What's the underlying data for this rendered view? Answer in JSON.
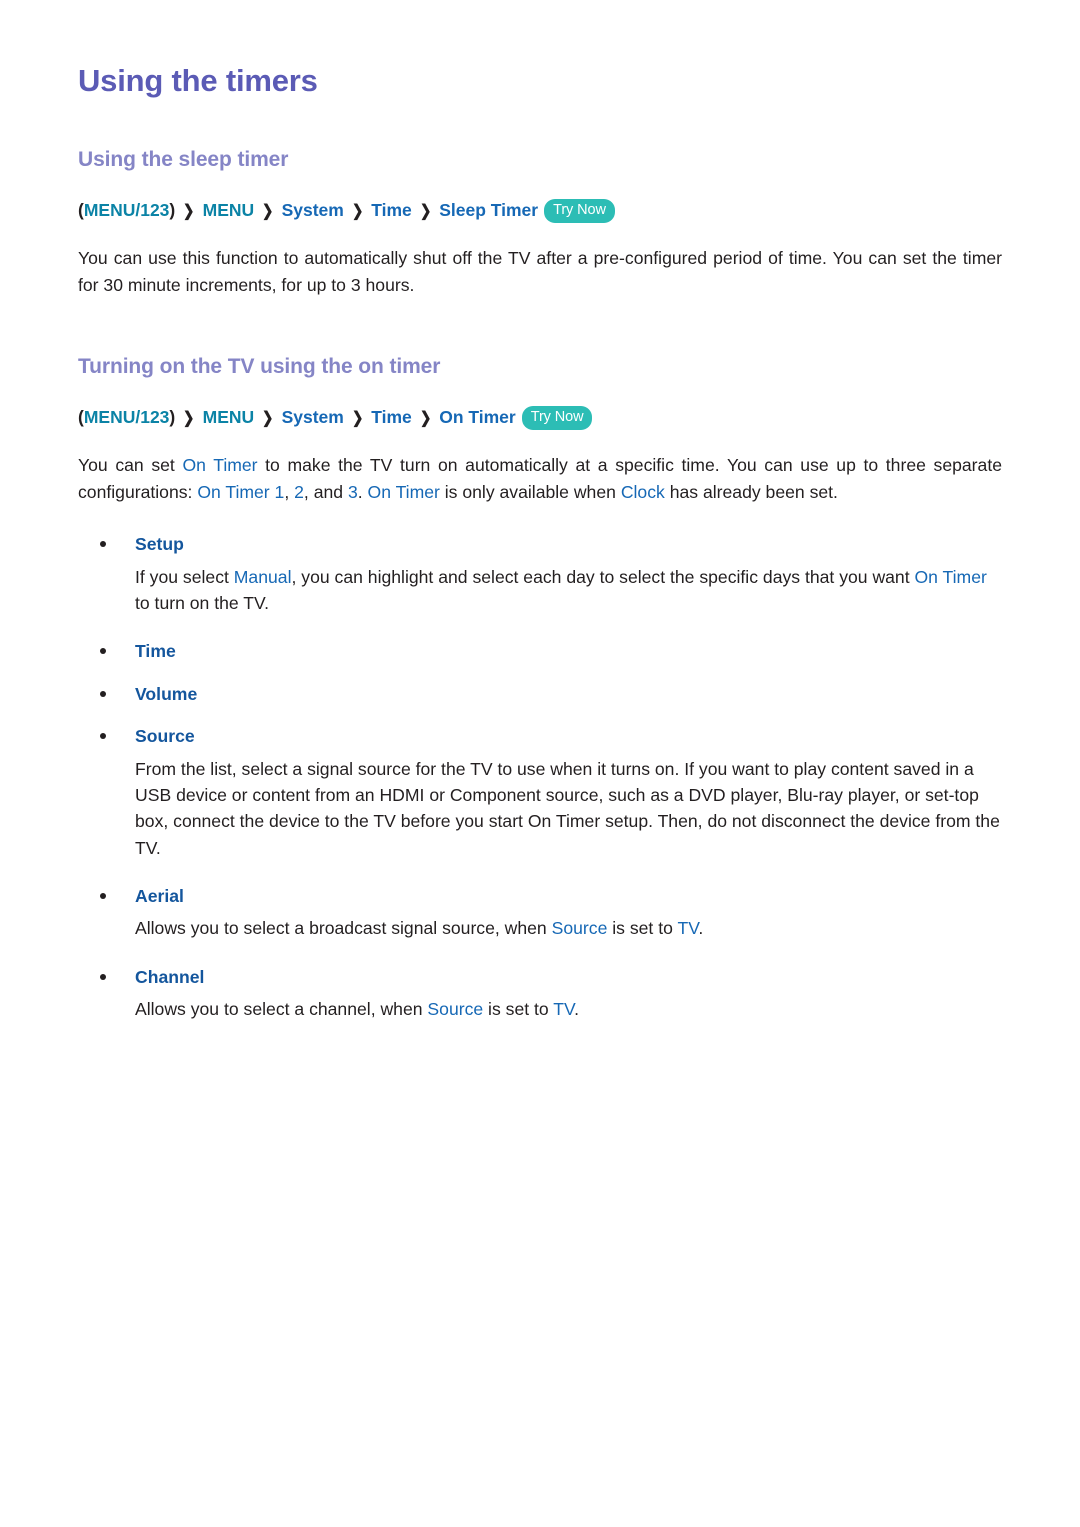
{
  "document": {
    "title": "Using the timers"
  },
  "colors": {
    "title": "#5b5bb5",
    "section_heading": "#8585c6",
    "breadcrumb_teal": "#0b83a6",
    "breadcrumb_blue": "#1668b5",
    "inline_term_blue": "#1668b5",
    "bullet_heading_blue": "#14569d",
    "try_now_badge": "#2cbdb5",
    "body_text": "#231f20"
  },
  "sections": [
    {
      "heading": "Using the sleep timer",
      "breadcrumb": {
        "open_paren": "(",
        "menu123": "MENU/123",
        "close_paren": ")",
        "arrow": "❯",
        "menu": "MENU",
        "system": "System",
        "time": "Time",
        "leaf": "Sleep Timer",
        "try_now": "Try Now"
      },
      "paragraph": {
        "part1": "You can use this function to automatically shut off the TV after a pre-configured period of time. You can set the timer for 30 minute increments, for up to 3 hours."
      }
    },
    {
      "heading": "Turning on the TV using the on timer",
      "breadcrumb": {
        "open_paren": "(",
        "menu123": "MENU/123",
        "close_paren": ")",
        "arrow": "❯",
        "menu": "MENU",
        "system": "System",
        "time": "Time",
        "leaf": "On Timer",
        "try_now": "Try Now"
      },
      "intro": {
        "t1": "You can set ",
        "b1": "On Timer",
        "t2": " to make the TV turn on automatically at a specific time. You can use up to three separate configurations: ",
        "b2": "On Timer 1",
        "t3": ", ",
        "b3": "2",
        "t4": ", and ",
        "b4": "3",
        "t5": ". ",
        "b5": "On Timer",
        "t6": " is only available when ",
        "b6": "Clock",
        "t7": " has already been set."
      }
    }
  ],
  "bullets": [
    {
      "label": "Setup",
      "body": {
        "t1": "If you select ",
        "b1": "Manual",
        "t2": ", you can highlight and select each day to select the specific days that you want ",
        "b2": "On Timer",
        "t3": " to turn on the TV."
      }
    },
    {
      "label": "Time",
      "body": null
    },
    {
      "label": "Volume",
      "body": null
    },
    {
      "label": "Source",
      "body": {
        "t1": "From the list, select a signal source for the TV to use when it turns on. If you want to play content saved in a USB device or content from an HDMI or Component source, such as a DVD player, Blu-ray player, or set-top box, connect the device to the TV before you start On Timer setup. Then, do not disconnect the device from the TV."
      }
    },
    {
      "label": "Aerial",
      "body": {
        "t1": "Allows you to select a broadcast signal source, when ",
        "b1": "Source",
        "t2": " is set to ",
        "b2": "TV",
        "t3": "."
      }
    },
    {
      "label": "Channel",
      "body": {
        "t1": "Allows you to select a channel, when ",
        "b1": "Source",
        "t2": " is set to ",
        "b2": "TV",
        "t3": "."
      }
    }
  ]
}
